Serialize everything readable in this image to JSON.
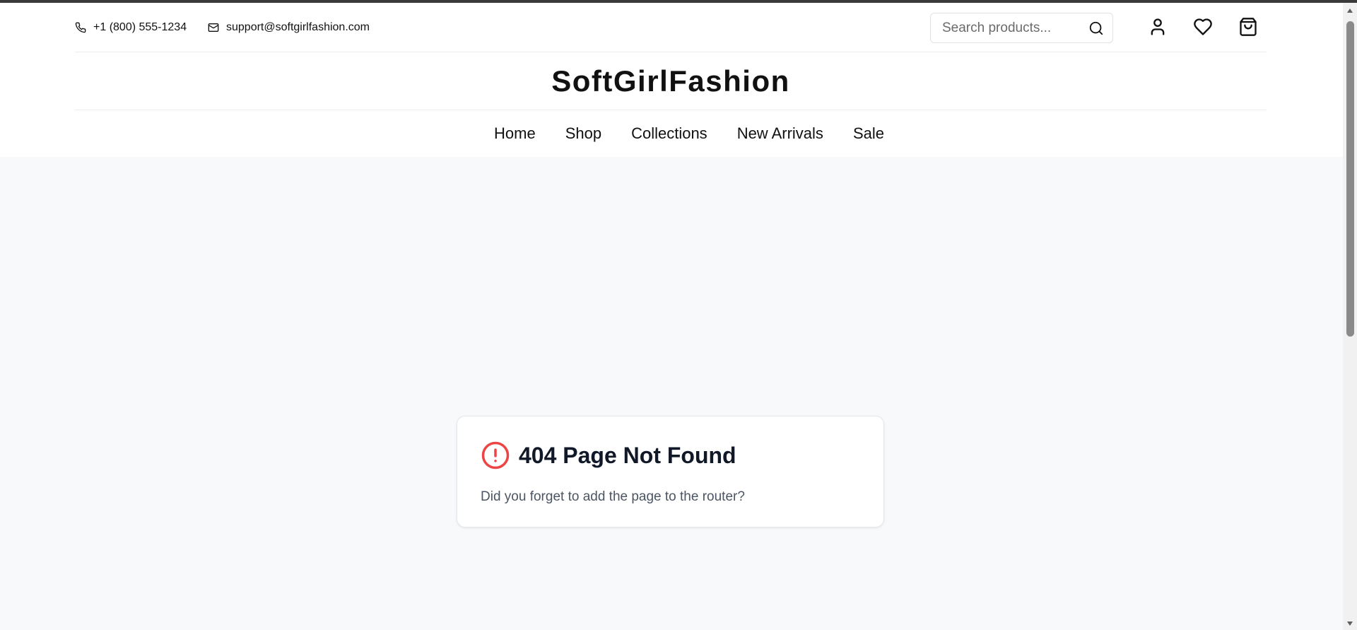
{
  "header": {
    "phone": "+1 (800) 555-1234",
    "email": "support@softgirlfashion.com",
    "search_placeholder": "Search products...",
    "brand": "SoftGirlFashion",
    "icons": [
      "phone-icon",
      "mail-icon",
      "search-icon",
      "user-icon",
      "heart-icon",
      "shopping-bag-icon"
    ]
  },
  "nav": {
    "items": [
      {
        "label": "Home"
      },
      {
        "label": "Shop"
      },
      {
        "label": "Collections"
      },
      {
        "label": "New Arrivals"
      },
      {
        "label": "Sale"
      }
    ]
  },
  "error": {
    "title": "404 Page Not Found",
    "message": "Did you forget to add the page to the router?",
    "icon": "alert-circle-icon",
    "icon_color": "#ef4444"
  },
  "colors": {
    "background": "#f8f9fb",
    "header_bg": "#ffffff",
    "text": "#111111",
    "muted_text": "#4b5563"
  }
}
